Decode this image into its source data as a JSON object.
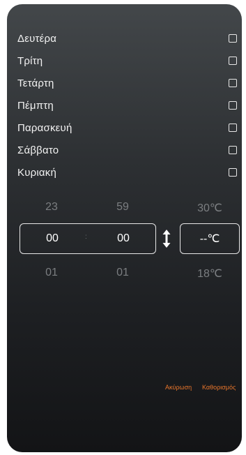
{
  "days": [
    {
      "label": "Δευτέρα",
      "checked": false
    },
    {
      "label": "Τρίτη",
      "checked": false
    },
    {
      "label": "Τετάρτη",
      "checked": false
    },
    {
      "label": "Πέμπτη",
      "checked": false
    },
    {
      "label": "Παρασκευή",
      "checked": false
    },
    {
      "label": "Σάββατο",
      "checked": false
    },
    {
      "label": "Κυριακή",
      "checked": false
    }
  ],
  "picker": {
    "hour_prev": "23",
    "hour_value": "00",
    "hour_next": "01",
    "minute_prev": "59",
    "minute_value": "00",
    "minute_next": "01",
    "separator": ":",
    "temp_prev": "30℃",
    "temp_value": "--℃",
    "temp_next": "18℃"
  },
  "actions": {
    "cancel_label": "Ακύρωση",
    "set_label": "Καθορισμός"
  },
  "colors": {
    "accent": "#e8762b",
    "dim_text": "#7b7e81"
  },
  "icons": {
    "toggle": "up-down-arrow-icon"
  }
}
